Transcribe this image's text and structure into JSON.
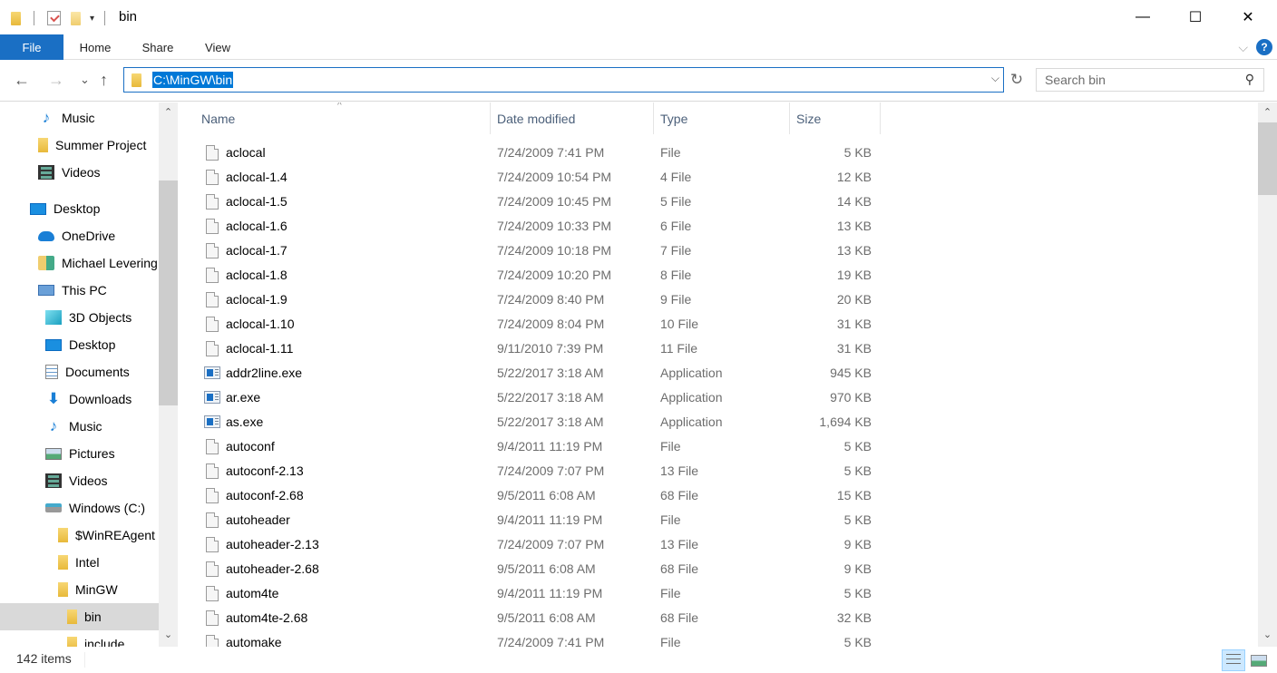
{
  "window": {
    "title": "bin",
    "controls": {
      "minimize": "—",
      "maximize": "☐",
      "close": "✕"
    }
  },
  "quick_access": {
    "dropdown_glyph": "▾"
  },
  "ribbon": {
    "tabs": [
      {
        "label": "File",
        "active": true
      },
      {
        "label": "Home"
      },
      {
        "label": "Share"
      },
      {
        "label": "View"
      }
    ],
    "collapse_glyph": "⌵",
    "help_glyph": "?"
  },
  "nav": {
    "back": "←",
    "forward": "→",
    "recent": "⌄",
    "up": "↑",
    "address": "C:\\MinGW\\bin",
    "address_dropdown": "⌵",
    "refresh": "↻",
    "search_placeholder": "Search bin",
    "search_icon": "⚲"
  },
  "sidebar": {
    "items": [
      {
        "label": "Music",
        "icon": "music-icon",
        "indent": 2
      },
      {
        "label": "Summer Project",
        "icon": "folder-icon",
        "indent": 2
      },
      {
        "label": "Videos",
        "icon": "videos-icon",
        "indent": 2
      },
      {
        "label": "Desktop",
        "icon": "desktop-icon",
        "indent": 1
      },
      {
        "label": "OneDrive",
        "icon": "onedrive-icon",
        "indent": 2
      },
      {
        "label": "Michael Levering",
        "icon": "user-folder-icon",
        "indent": 2
      },
      {
        "label": "This PC",
        "icon": "this-pc-icon",
        "indent": 2
      },
      {
        "label": "3D Objects",
        "icon": "3d-objects-icon",
        "indent": 3
      },
      {
        "label": "Desktop",
        "icon": "desktop-icon",
        "indent": 3
      },
      {
        "label": "Documents",
        "icon": "documents-icon",
        "indent": 3
      },
      {
        "label": "Downloads",
        "icon": "downloads-icon",
        "indent": 3
      },
      {
        "label": "Music",
        "icon": "music-icon",
        "indent": 3
      },
      {
        "label": "Pictures",
        "icon": "pictures-icon",
        "indent": 3
      },
      {
        "label": "Videos",
        "icon": "videos-icon",
        "indent": 3
      },
      {
        "label": "Windows (C:)",
        "icon": "drive-icon",
        "indent": 3
      },
      {
        "label": "$WinREAgent",
        "icon": "folder-icon",
        "indent": 4
      },
      {
        "label": "Intel",
        "icon": "folder-icon",
        "indent": 4
      },
      {
        "label": "MinGW",
        "icon": "folder-icon",
        "indent": 4
      },
      {
        "label": "bin",
        "icon": "folder-icon",
        "indent": 5,
        "selected": true
      },
      {
        "label": "include",
        "icon": "folder-icon",
        "indent": 5
      }
    ],
    "scroll_up": "⌃",
    "scroll_down": "⌄"
  },
  "columns": {
    "name": "Name",
    "date": "Date modified",
    "type": "Type",
    "size": "Size",
    "sort_glyph": "^"
  },
  "files": [
    {
      "name": "aclocal",
      "date": "7/24/2009 7:41 PM",
      "type": "File",
      "size": "5 KB",
      "kind": "file"
    },
    {
      "name": "aclocal-1.4",
      "date": "7/24/2009 10:54 PM",
      "type": "4 File",
      "size": "12 KB",
      "kind": "file"
    },
    {
      "name": "aclocal-1.5",
      "date": "7/24/2009 10:45 PM",
      "type": "5 File",
      "size": "14 KB",
      "kind": "file"
    },
    {
      "name": "aclocal-1.6",
      "date": "7/24/2009 10:33 PM",
      "type": "6 File",
      "size": "13 KB",
      "kind": "file"
    },
    {
      "name": "aclocal-1.7",
      "date": "7/24/2009 10:18 PM",
      "type": "7 File",
      "size": "13 KB",
      "kind": "file"
    },
    {
      "name": "aclocal-1.8",
      "date": "7/24/2009 10:20 PM",
      "type": "8 File",
      "size": "19 KB",
      "kind": "file"
    },
    {
      "name": "aclocal-1.9",
      "date": "7/24/2009 8:40 PM",
      "type": "9 File",
      "size": "20 KB",
      "kind": "file"
    },
    {
      "name": "aclocal-1.10",
      "date": "7/24/2009 8:04 PM",
      "type": "10 File",
      "size": "31 KB",
      "kind": "file"
    },
    {
      "name": "aclocal-1.11",
      "date": "9/11/2010 7:39 PM",
      "type": "11 File",
      "size": "31 KB",
      "kind": "file"
    },
    {
      "name": "addr2line.exe",
      "date": "5/22/2017 3:18 AM",
      "type": "Application",
      "size": "945 KB",
      "kind": "app"
    },
    {
      "name": "ar.exe",
      "date": "5/22/2017 3:18 AM",
      "type": "Application",
      "size": "970 KB",
      "kind": "app"
    },
    {
      "name": "as.exe",
      "date": "5/22/2017 3:18 AM",
      "type": "Application",
      "size": "1,694 KB",
      "kind": "app"
    },
    {
      "name": "autoconf",
      "date": "9/4/2011 11:19 PM",
      "type": "File",
      "size": "5 KB",
      "kind": "file"
    },
    {
      "name": "autoconf-2.13",
      "date": "7/24/2009 7:07 PM",
      "type": "13 File",
      "size": "5 KB",
      "kind": "file"
    },
    {
      "name": "autoconf-2.68",
      "date": "9/5/2011 6:08 AM",
      "type": "68 File",
      "size": "15 KB",
      "kind": "file"
    },
    {
      "name": "autoheader",
      "date": "9/4/2011 11:19 PM",
      "type": "File",
      "size": "5 KB",
      "kind": "file"
    },
    {
      "name": "autoheader-2.13",
      "date": "7/24/2009 7:07 PM",
      "type": "13 File",
      "size": "9 KB",
      "kind": "file"
    },
    {
      "name": "autoheader-2.68",
      "date": "9/5/2011 6:08 AM",
      "type": "68 File",
      "size": "9 KB",
      "kind": "file"
    },
    {
      "name": "autom4te",
      "date": "9/4/2011 11:19 PM",
      "type": "File",
      "size": "5 KB",
      "kind": "file"
    },
    {
      "name": "autom4te-2.68",
      "date": "9/5/2011 6:08 AM",
      "type": "68 File",
      "size": "32 KB",
      "kind": "file"
    },
    {
      "name": "automake",
      "date": "7/24/2009 7:41 PM",
      "type": "File",
      "size": "5 KB",
      "kind": "file"
    }
  ],
  "status": {
    "item_count": "142 items",
    "view_mode": "details"
  }
}
